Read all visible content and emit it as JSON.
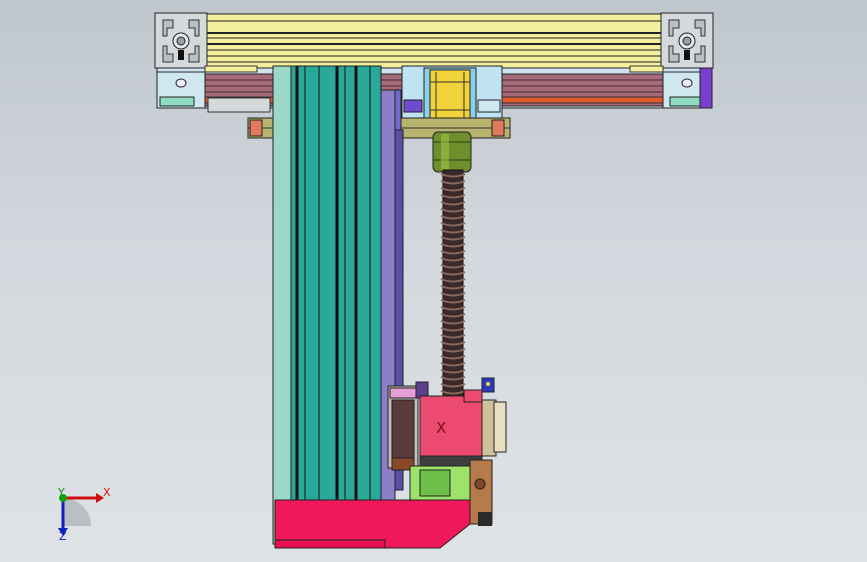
{
  "model_view": {
    "carriage_marking": "X"
  },
  "triad": {
    "x_label": "X",
    "y_label": "Y",
    "z_label": "Z",
    "colors": {
      "x": "#d01010",
      "y": "#10a010",
      "z": "#1020c0"
    }
  },
  "colors": {
    "background_top": "#bfc6cd",
    "background_bottom": "#dfe3e6",
    "beam_face": "#f3ef9c",
    "profile_gray": "#d5d9dc",
    "column_teal": "#2aa899",
    "rail_purple": "#8c7fc8",
    "carriage_red": "#ec4a6e",
    "base_magenta": "#f0185a",
    "screw_dark": "#3a2a2a",
    "coupler_olive": "#6f8f2c"
  },
  "icons": {
    "triad": "coordinate-triad-icon"
  }
}
